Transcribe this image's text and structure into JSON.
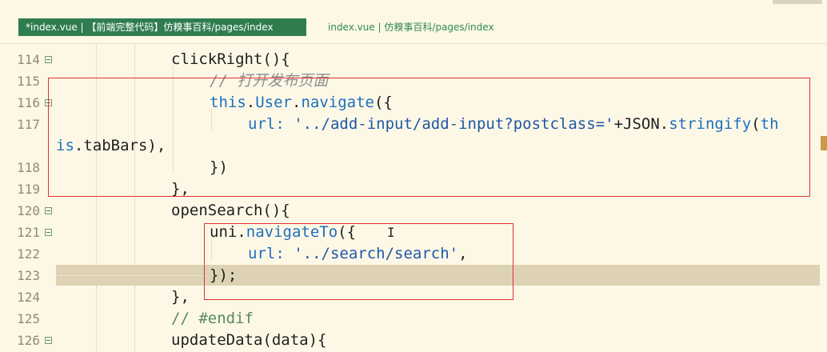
{
  "tabs": [
    {
      "label": "*index.vue | 【前端完整代码】仿糗事百科/pages/index",
      "active": true
    },
    {
      "label": "index.vue | 仿糗事百科/pages/index",
      "active": false
    }
  ],
  "editor": {
    "lines": [
      {
        "num": "114",
        "fold": true
      },
      {
        "num": "115",
        "fold": false
      },
      {
        "num": "116",
        "fold": true
      },
      {
        "num": "117",
        "fold": false
      },
      {
        "num": "",
        "fold": false
      },
      {
        "num": "118",
        "fold": false
      },
      {
        "num": "119",
        "fold": false
      },
      {
        "num": "120",
        "fold": true
      },
      {
        "num": "121",
        "fold": true
      },
      {
        "num": "122",
        "fold": false
      },
      {
        "num": "123",
        "fold": false
      },
      {
        "num": "124",
        "fold": false
      },
      {
        "num": "125",
        "fold": false
      },
      {
        "num": "126",
        "fold": true
      }
    ],
    "tokens": {
      "l114": "clickRight(){",
      "l115": "// 打开发布页面",
      "l116_this": "this",
      "l116_dot1": ".",
      "l116_user": "User",
      "l116_dot2": ".",
      "l116_nav": "navigate",
      "l116_rest": "({",
      "l117_key": "url: ",
      "l117_str": "'../add-input/add-input?postclass='",
      "l117_plus": "+JSON.",
      "l117_fn": "stringify",
      "l117_paren": "(",
      "l117_th": "th",
      "l117w_is": "is",
      "l117w_rest": ".tabBars),",
      "l118": "})",
      "l119": "},",
      "l120": "openSearch(){",
      "l121_uni": "uni.",
      "l121_fn": "navigateTo",
      "l121_rest": "({",
      "l122_key": "url: ",
      "l122_str": "'../search/search'",
      "l122_comma": ",",
      "l123": "});",
      "l124": "},",
      "l125": "// #endif",
      "l126": "updateData(data){"
    }
  },
  "cursor": "I"
}
